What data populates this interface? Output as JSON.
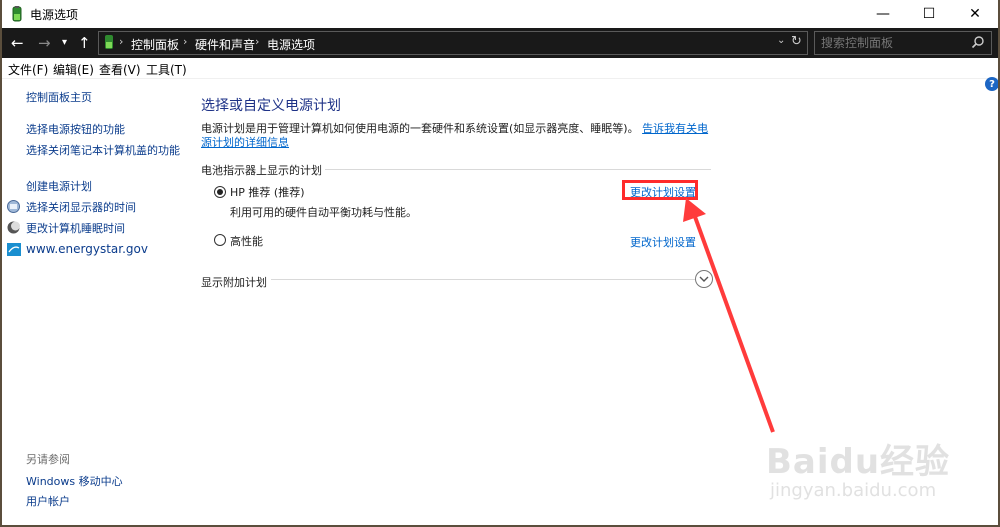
{
  "window": {
    "title": "电源选项",
    "controls": {
      "minimize": "—",
      "maximize": "☐",
      "close": "✕"
    }
  },
  "addressbar": {
    "breadcrumbs": [
      "控制面板",
      "硬件和声音",
      "电源选项"
    ],
    "search_placeholder": "搜索控制面板"
  },
  "menubar": {
    "items": [
      "文件(F)",
      "编辑(E)",
      "查看(V)",
      "工具(T)"
    ]
  },
  "sidebar": {
    "home": "控制面板主页",
    "items": [
      {
        "label": "选择电源按钮的功能",
        "icon": "none"
      },
      {
        "label": "选择关闭笔记本计算机盖的功能",
        "icon": "none"
      },
      {
        "label": "创建电源计划",
        "icon": "none"
      },
      {
        "label": "选择关闭显示器的时间",
        "icon": "display-icon"
      },
      {
        "label": "更改计算机睡眠时间",
        "icon": "moon-icon"
      },
      {
        "label": "www.energystar.gov",
        "icon": "energystar-icon"
      }
    ],
    "see_also_title": "另请参阅",
    "see_also": [
      "Windows 移动中心",
      "用户帐户"
    ]
  },
  "main": {
    "title": "选择或自定义电源计划",
    "description": "电源计划是用于管理计算机如何使用电源的一套硬件和系统设置(如显示器亮度、睡眠等)。",
    "description_link": "告诉我有关电源计划的详细信息",
    "section_title": "电池指示器上显示的计划",
    "plans": [
      {
        "name": "HP 推荐 (推荐)",
        "description": "利用可用的硬件自动平衡功耗与性能。",
        "selected": true,
        "link": "更改计划设置"
      },
      {
        "name": "高性能",
        "description": "",
        "selected": false,
        "link": "更改计划设置"
      }
    ],
    "additional_plans": "显示附加计划"
  },
  "watermark": {
    "logo": "Baidu经验",
    "url": "jingyan.baidu.com"
  },
  "colors": {
    "accent_link": "#0066cc",
    "title_blue": "#1e3287",
    "annotation_red": "#ff2b2b",
    "addressbar_bg": "#191919"
  }
}
